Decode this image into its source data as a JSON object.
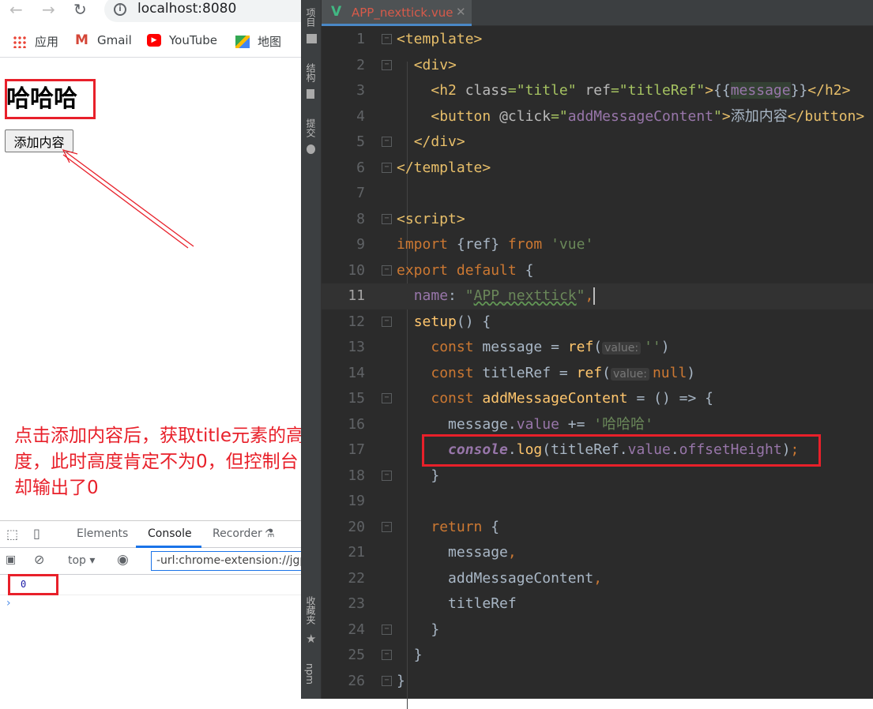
{
  "browser": {
    "url": "localhost:8080",
    "bookmarks": [
      {
        "label": "应用",
        "icon": "apps-grid-icon"
      },
      {
        "label": "Gmail",
        "icon": "gmail-icon"
      },
      {
        "label": "YouTube",
        "icon": "youtube-icon"
      },
      {
        "label": "地图",
        "icon": "maps-icon"
      }
    ],
    "page": {
      "heading": "哈哈哈",
      "button_label": "添加内容"
    },
    "annotation": "点击添加内容后，获取title元素的高度，此时高度肯定不为0，但控制台却输出了0",
    "devtools": {
      "tabs": [
        "Elements",
        "Console",
        "Recorder"
      ],
      "active_tab": "Console",
      "context": "top",
      "filter_value": "-url:chrome-extension://jgp",
      "log_output": "0",
      "prompt": "›"
    }
  },
  "ide": {
    "side_tools": [
      "项目",
      "结构",
      "提交",
      "收藏夹",
      "npm"
    ],
    "file_tab": "APP_nexttick.vue",
    "current_line": 11,
    "colors": {
      "background": "#2b2b2b",
      "tag": "#e8bf6a",
      "keyword": "#cc7832",
      "string": "#6a8759",
      "annotation_red": "#e8202a"
    },
    "lines": [
      [
        [
          "<template>",
          "tag"
        ]
      ],
      [
        [
          "  ",
          "plain"
        ],
        [
          "<div>",
          "tag"
        ]
      ],
      [
        [
          "    ",
          "plain"
        ],
        [
          "<h2 ",
          "tag"
        ],
        [
          "class",
          "attr"
        ],
        [
          "=\"title\" ",
          "aval"
        ],
        [
          "ref",
          "attr"
        ],
        [
          "=\"titleRef\"",
          "aval"
        ],
        [
          ">",
          "tag"
        ],
        [
          "{{",
          "plain"
        ],
        [
          "message",
          "interp"
        ],
        [
          "}}",
          "plain"
        ],
        [
          "</h2>",
          "tag"
        ]
      ],
      [
        [
          "    ",
          "plain"
        ],
        [
          "<button ",
          "tag"
        ],
        [
          "@click",
          "attr"
        ],
        [
          "=\"",
          "aval"
        ],
        [
          "addMessageContent",
          "purple"
        ],
        [
          "\"",
          "aval"
        ],
        [
          ">",
          "tag"
        ],
        [
          "添加内容",
          "plain"
        ],
        [
          "</button>",
          "tag"
        ]
      ],
      [
        [
          "  ",
          "plain"
        ],
        [
          "</div>",
          "tag"
        ]
      ],
      [
        [
          "</template>",
          "tag"
        ]
      ],
      [],
      [
        [
          "<script>",
          "tag"
        ]
      ],
      [
        [
          "import ",
          "kw"
        ],
        [
          "{",
          "plain"
        ],
        [
          "ref",
          "plain"
        ],
        [
          "} ",
          "plain"
        ],
        [
          "from ",
          "kw"
        ],
        [
          "'vue'",
          "str"
        ]
      ],
      [
        [
          "export default ",
          "kw"
        ],
        [
          "{",
          "plain"
        ]
      ],
      [
        [
          "  ",
          "plain"
        ],
        [
          "name",
          "purple"
        ],
        [
          ": ",
          "plain"
        ],
        [
          "\"",
          "str"
        ],
        [
          "APP_nexttick",
          "str warn"
        ],
        [
          "\"",
          "str"
        ],
        [
          ",",
          "kw"
        ]
      ],
      [
        [
          "  ",
          "plain"
        ],
        [
          "setup",
          "fn"
        ],
        [
          "() {",
          "plain"
        ]
      ],
      [
        [
          "    ",
          "plain"
        ],
        [
          "const ",
          "kw"
        ],
        [
          "message = ",
          "plain"
        ],
        [
          "ref",
          "fn"
        ],
        [
          "(",
          "plain"
        ],
        [
          "value:",
          "hint"
        ],
        [
          "''",
          "str"
        ],
        [
          ")",
          "plain"
        ]
      ],
      [
        [
          "    ",
          "plain"
        ],
        [
          "const ",
          "kw"
        ],
        [
          "titleRef = ",
          "plain"
        ],
        [
          "ref",
          "fn"
        ],
        [
          "(",
          "plain"
        ],
        [
          "value:",
          "hint"
        ],
        [
          "null",
          "kw"
        ],
        [
          ")",
          "plain"
        ]
      ],
      [
        [
          "    ",
          "plain"
        ],
        [
          "const ",
          "kw"
        ],
        [
          "addMessageContent",
          "fn"
        ],
        [
          " = () => {",
          "plain"
        ]
      ],
      [
        [
          "      ",
          "plain"
        ],
        [
          "message.",
          "plain"
        ],
        [
          "value",
          "purple"
        ],
        [
          " += ",
          "plain"
        ],
        [
          "'哈哈哈'",
          "str"
        ]
      ],
      [
        [
          "      ",
          "plain"
        ],
        [
          "console",
          "console"
        ],
        [
          ".",
          "plain"
        ],
        [
          "log",
          "fnc"
        ],
        [
          "(titleRef.",
          "plain"
        ],
        [
          "value",
          "purple"
        ],
        [
          ".",
          "plain"
        ],
        [
          "offsetHeight",
          "purple"
        ],
        [
          ")",
          "plain"
        ],
        [
          ";",
          "kw"
        ]
      ],
      [
        [
          "    ",
          "plain"
        ],
        [
          "}",
          "plain"
        ]
      ],
      [],
      [
        [
          "    ",
          "plain"
        ],
        [
          "return ",
          "kw"
        ],
        [
          "{",
          "plain"
        ]
      ],
      [
        [
          "      ",
          "plain"
        ],
        [
          "message",
          "plain"
        ],
        [
          ",",
          "kw"
        ]
      ],
      [
        [
          "      ",
          "plain"
        ],
        [
          "addMessageContent",
          "plain"
        ],
        [
          ",",
          "kw"
        ]
      ],
      [
        [
          "      ",
          "plain"
        ],
        [
          "titleRef",
          "plain"
        ]
      ],
      [
        [
          "    ",
          "plain"
        ],
        [
          "}",
          "plain"
        ]
      ],
      [
        [
          "  ",
          "plain"
        ],
        [
          "}",
          "plain"
        ]
      ],
      [
        [
          "}",
          "plain"
        ]
      ]
    ]
  }
}
